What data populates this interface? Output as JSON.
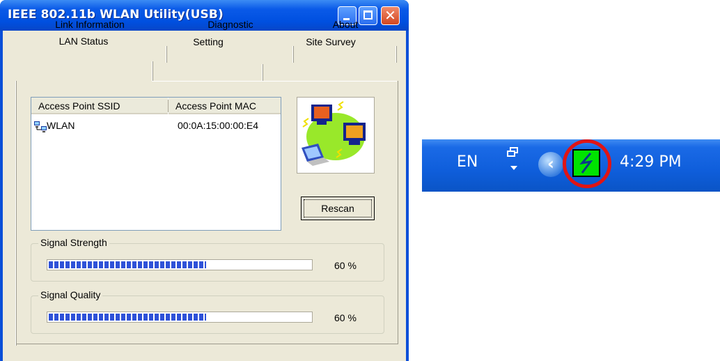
{
  "window": {
    "title": "IEEE 802.11b WLAN Utility(USB)"
  },
  "tabs": {
    "row1": [
      "Link Information",
      "Diagnostic",
      "About"
    ],
    "row2": [
      "LAN Status",
      "Setting",
      "Site Survey"
    ],
    "active": "LAN Status"
  },
  "ap_list": {
    "columns": [
      "Access Point SSID",
      "Access Point MAC"
    ],
    "rows": [
      {
        "ssid": "WLAN",
        "mac": "00:0A:15:00:00:E4",
        "icon": "network-computers-icon"
      }
    ]
  },
  "picture": {
    "icon": "wireless-network-computers-icon"
  },
  "rescan_label": "Rescan",
  "signal_strength": {
    "label": "Signal Strength",
    "value_text": "60 %",
    "level": 0.6
  },
  "signal_quality": {
    "label": "Signal Quality",
    "value_text": "60 %",
    "level": 0.6
  },
  "taskbar": {
    "language": "EN",
    "time": "4:29 PM",
    "icons": [
      "network-status-icon",
      "show-hidden-icons-chevron",
      "wlan-utility-tray-icon"
    ],
    "highlight_color": "#e01414",
    "tray_icon_color": "#00e400"
  }
}
